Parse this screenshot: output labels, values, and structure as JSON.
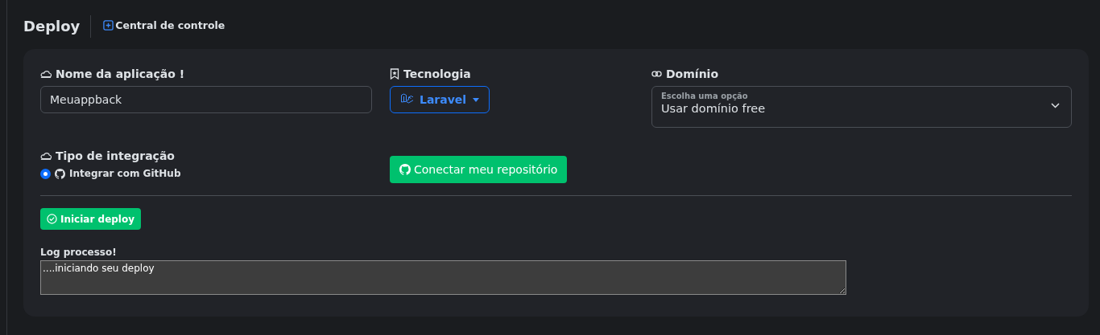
{
  "header": {
    "title": "Deploy",
    "link": "Central de controle"
  },
  "app_name": {
    "label": "Nome da aplicação !",
    "value": "Meuappback"
  },
  "technology": {
    "label": "Tecnologia",
    "value": "Laravel"
  },
  "domain": {
    "label": "Domínio",
    "floating_label": "Escolha uma opção",
    "value": "Usar domínio free"
  },
  "integration": {
    "label": "Tipo de integração",
    "options": [
      {
        "label": "Integrar com GitHub",
        "selected": true
      }
    ]
  },
  "connect_button": "Conectar meu repositório",
  "deploy_button": "Iniciar deploy",
  "log": {
    "label": "Log processo!",
    "value": "....iniciando seu deploy"
  }
}
